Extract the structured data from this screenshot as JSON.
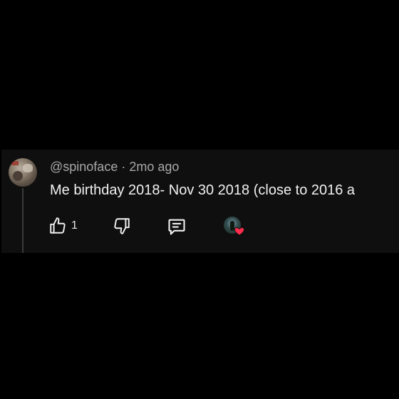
{
  "comment": {
    "author": "@spinoface",
    "separator": "·",
    "time_ago": "2mo ago",
    "text": "Me birthday 2018- Nov 30 2018 (close to 2016 a",
    "like_count": "1"
  },
  "icons": {
    "avatar": "user-avatar",
    "like": "thumbs-up-icon",
    "dislike": "thumbs-down-icon",
    "reply": "comment-bubble-icon",
    "creator_heart": "creator-heart-icon"
  },
  "colors": {
    "background": "#000000",
    "card": "#0f0f0f",
    "meta_text": "#a8a8a8",
    "body_text": "#f1f1f1",
    "heart": "#ff2d4d"
  }
}
